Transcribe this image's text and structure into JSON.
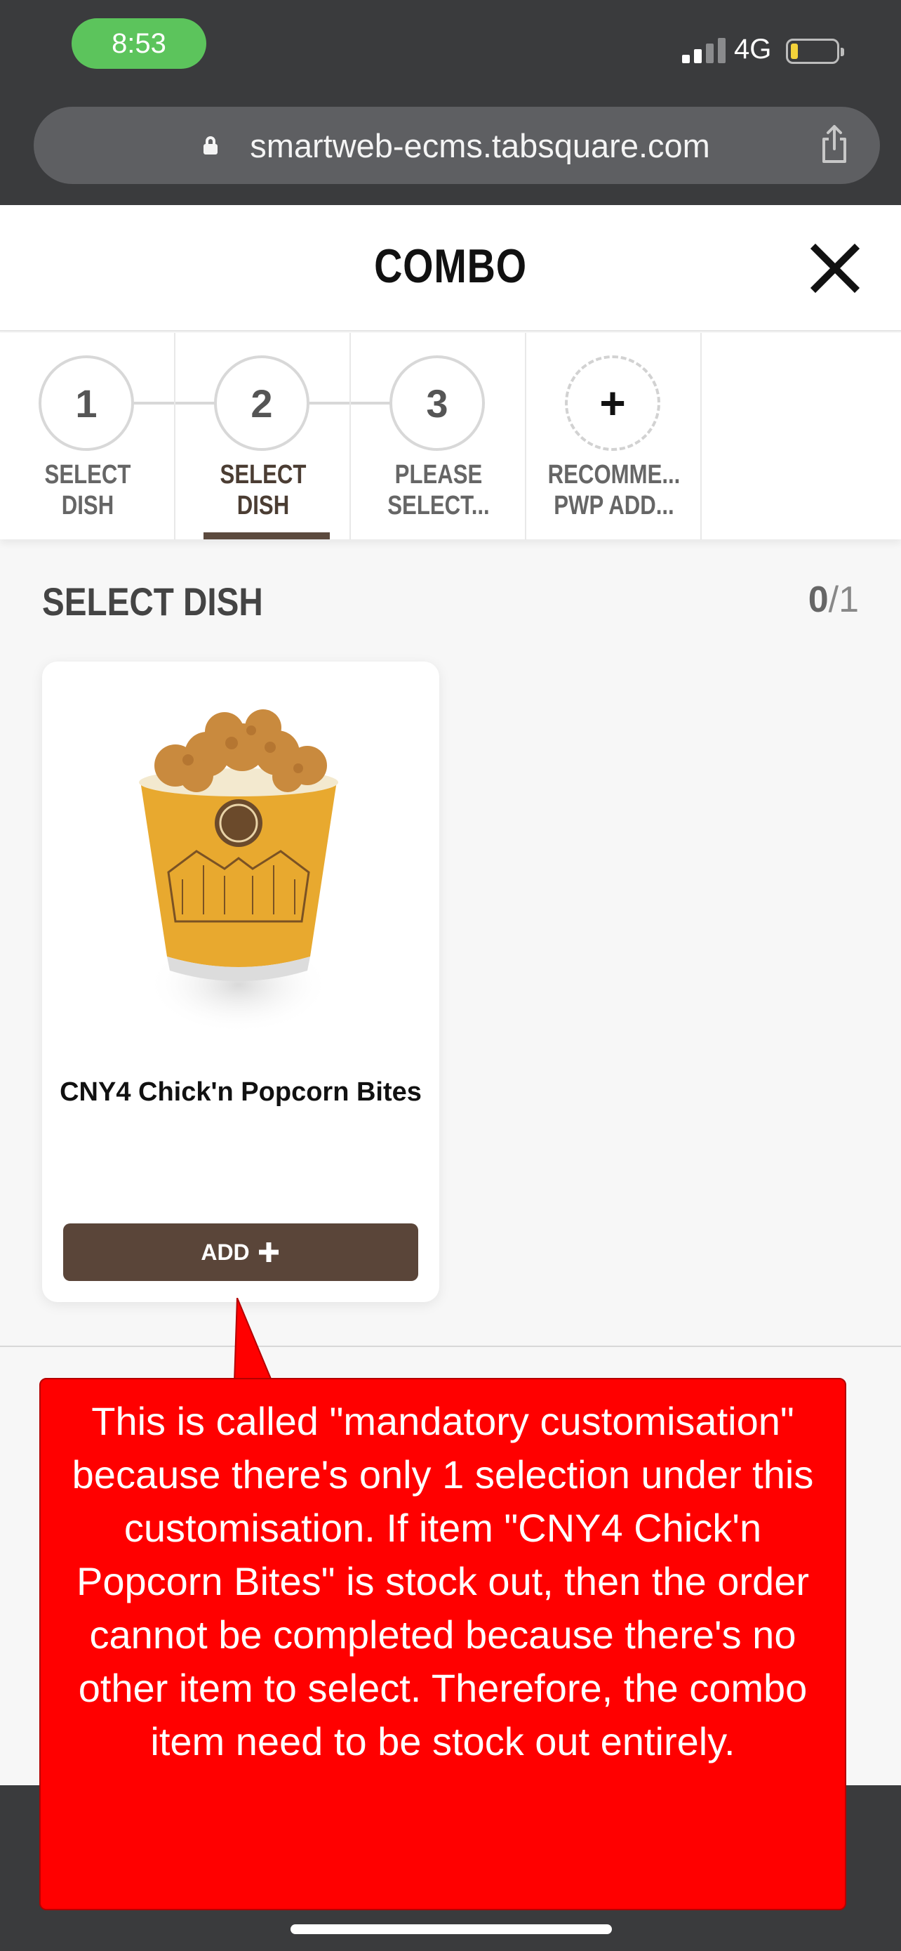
{
  "status_bar": {
    "time": "8:53",
    "network": "4G",
    "colors": {
      "time_pill": "#5cc45c",
      "battery_fill": "#f3d23a"
    }
  },
  "browser": {
    "url": "smartweb-ecms.tabsquare.com",
    "icons": [
      "lock-icon",
      "share-icon"
    ]
  },
  "header": {
    "title": "COMBO",
    "close_icon": "close-icon"
  },
  "stepper": {
    "steps": [
      {
        "number": "1",
        "label_line1": "SELECT DISH",
        "label_line2": "",
        "active": false
      },
      {
        "number": "2",
        "label_line1": "SELECT DISH",
        "label_line2": "",
        "active": true
      },
      {
        "number": "3",
        "label_line1": "PLEASE",
        "label_line2": "SELECT...",
        "active": false
      },
      {
        "number": "+",
        "label_line1": "RECOMME...",
        "label_line2": "PWP ADD...",
        "active": false
      }
    ]
  },
  "section": {
    "title": "SELECT DISH",
    "selected_count": "0",
    "max_count": "/1"
  },
  "dish": {
    "name": "CNY4 Chick'n Popcorn Bites",
    "add_label": "ADD",
    "add_icon": "plus-icon"
  },
  "annotation": {
    "text": "This is called \"mandatory customisation\" because there's only 1 selection under this customisation. If item \"CNY4 Chick'n Popcorn Bites\" is stock out, then the order cannot be completed because there's no other item to select. Therefore, the combo item need to be stock out entirely."
  },
  "colors": {
    "accent_brown": "#5a4539",
    "annotation_red": "#ff0000"
  }
}
